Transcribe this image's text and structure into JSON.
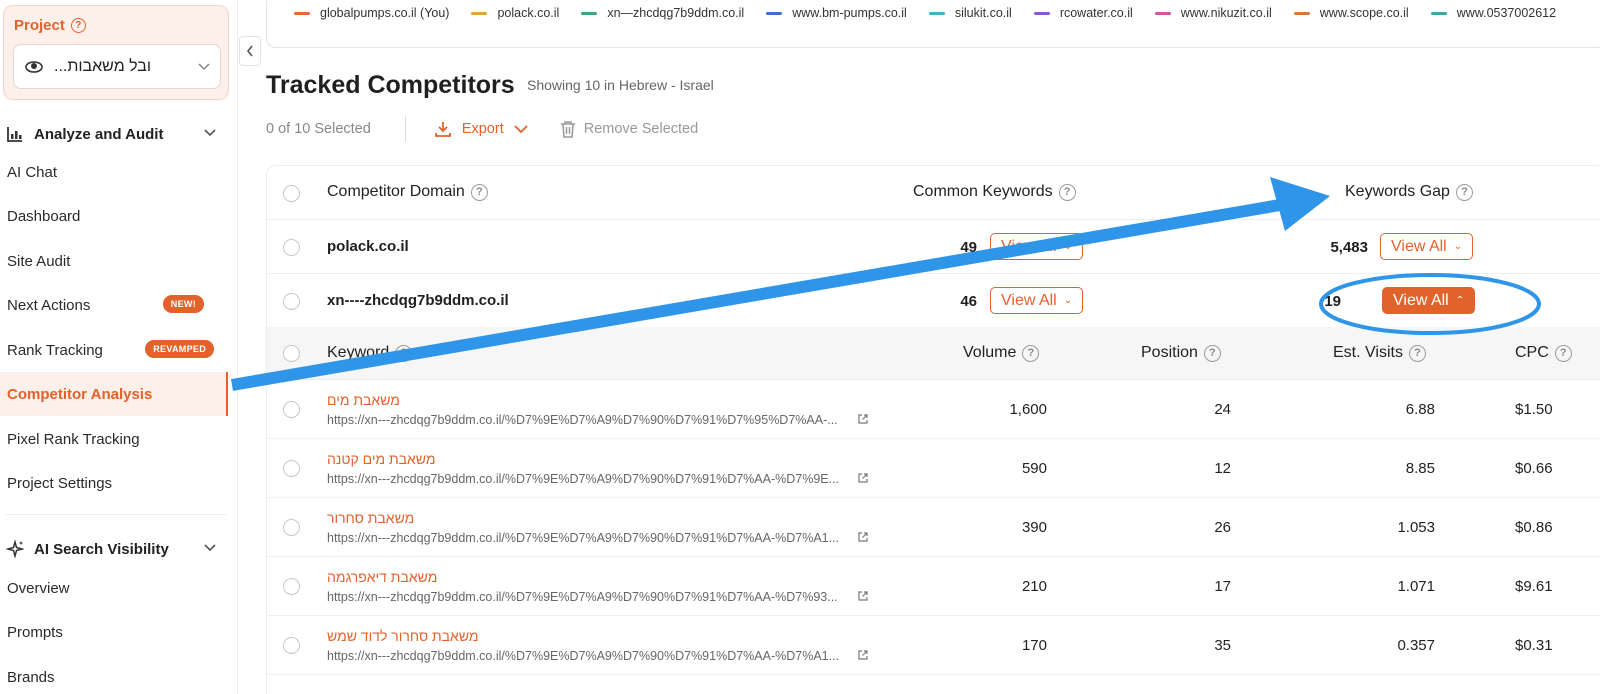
{
  "sidebar": {
    "project_label": "Project",
    "project_name": "...ובל משאבות",
    "analyze_section": "Analyze and Audit",
    "analyze_items": [
      {
        "label": "AI Chat"
      },
      {
        "label": "Dashboard"
      },
      {
        "label": "Site Audit"
      },
      {
        "label": "Next Actions",
        "badge": "NEW!"
      },
      {
        "label": "Rank Tracking",
        "badge": "REVAMPED"
      },
      {
        "label": "Competitor Analysis",
        "active": true
      },
      {
        "label": "Pixel Rank Tracking"
      },
      {
        "label": "Project Settings"
      }
    ],
    "ai_section": "AI Search Visibility",
    "ai_items": [
      {
        "label": "Overview"
      },
      {
        "label": "Prompts"
      },
      {
        "label": "Brands"
      }
    ]
  },
  "legend": [
    {
      "label": "globalpumps.co.il (You)",
      "color": "#e8663a"
    },
    {
      "label": "polack.co.il",
      "color": "#e3a33a"
    },
    {
      "label": "xn—zhcdqg7b9ddm.co.il",
      "color": "#3aa77a"
    },
    {
      "label": "www.bm-pumps.co.il",
      "color": "#3c6fd4"
    },
    {
      "label": "silukit.co.il",
      "color": "#44b0c4"
    },
    {
      "label": "rcowater.co.il",
      "color": "#8a57d6"
    },
    {
      "label": "www.nikuzit.co.il",
      "color": "#d6549a"
    },
    {
      "label": "www.scope.co.il",
      "color": "#d9773a"
    },
    {
      "label": "www.0537002612",
      "color": "#3aa79a"
    }
  ],
  "header": {
    "title": "Tracked Competitors",
    "subtitle": "Showing 10 in Hebrew - Israel"
  },
  "toolbar": {
    "selected": "0 of 10 Selected",
    "export": "Export",
    "remove": "Remove Selected"
  },
  "table": {
    "columns": {
      "domain": "Competitor Domain",
      "common": "Common Keywords",
      "gap": "Keywords Gap"
    },
    "view_all": "View All",
    "rows": [
      {
        "domain": "polack.co.il",
        "common": "49",
        "gap": "5,483"
      },
      {
        "domain": "xn----zhcdqg7b9ddm.co.il",
        "common": "46",
        "gap": "19"
      }
    ],
    "sub_columns": {
      "keyword": "Keyword",
      "volume": "Volume",
      "position": "Position",
      "visits": "Est. Visits",
      "cpc": "CPC"
    },
    "keywords": [
      {
        "kw": "משאבת מים",
        "url": "https://xn---zhcdqg7b9ddm.co.il/%D7%9E%D7%A9%D7%90%D7%91%D7%95%D7%AA-...",
        "volume": "1,600",
        "position": "24",
        "visits": "6.88",
        "cpc": "$1.50"
      },
      {
        "kw": "משאבת מים קטנה",
        "url": "https://xn---zhcdqg7b9ddm.co.il/%D7%9E%D7%A9%D7%90%D7%91%D7%AA-%D7%9E...",
        "volume": "590",
        "position": "12",
        "visits": "8.85",
        "cpc": "$0.66"
      },
      {
        "kw": "משאבת סחרור",
        "url": "https://xn---zhcdqg7b9ddm.co.il/%D7%9E%D7%A9%D7%90%D7%91%D7%AA-%D7%A1...",
        "volume": "390",
        "position": "26",
        "visits": "1.053",
        "cpc": "$0.86"
      },
      {
        "kw": "משאבת דיאפרגמה",
        "url": "https://xn---zhcdqg7b9ddm.co.il/%D7%9E%D7%A9%D7%90%D7%91%D7%AA-%D7%93...",
        "volume": "210",
        "position": "17",
        "visits": "1.071",
        "cpc": "$9.61"
      },
      {
        "kw": "משאבת סחרור לדוד שמש",
        "url": "https://xn---zhcdqg7b9ddm.co.il/%D7%9E%D7%A9%D7%90%D7%91%D7%AA-%D7%A1...",
        "volume": "170",
        "position": "35",
        "visits": "0.357",
        "cpc": "$0.31"
      }
    ]
  },
  "colors": {
    "accent": "#e2622c",
    "annotation": "#2f95e8"
  }
}
